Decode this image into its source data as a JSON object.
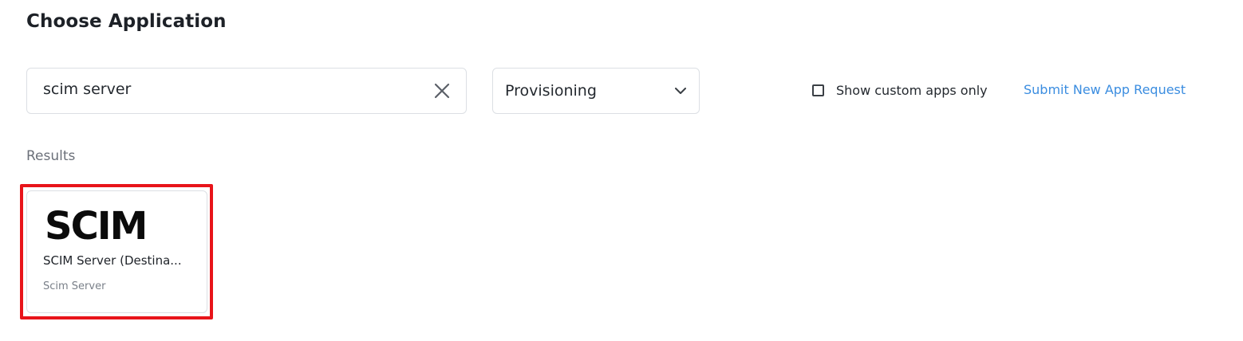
{
  "header": {
    "title": "Choose Application"
  },
  "search": {
    "value": "scim server",
    "placeholder": ""
  },
  "filter": {
    "selected": "Provisioning"
  },
  "custom_apps": {
    "label": "Show custom apps only",
    "checked": false
  },
  "submit_request": {
    "label": "Submit New App Request"
  },
  "results": {
    "label": "Results",
    "items": [
      {
        "logo_text": "SCIM",
        "title": "SCIM Server (Destina...",
        "subtitle": "Scim Server"
      }
    ]
  },
  "colors": {
    "link": "#3b8de0",
    "highlight": "#e8141a",
    "border": "#dcdfe4"
  },
  "icons": {
    "clear": "close-icon",
    "dropdown": "chevron-down-icon",
    "checkbox": "checkbox-icon"
  }
}
